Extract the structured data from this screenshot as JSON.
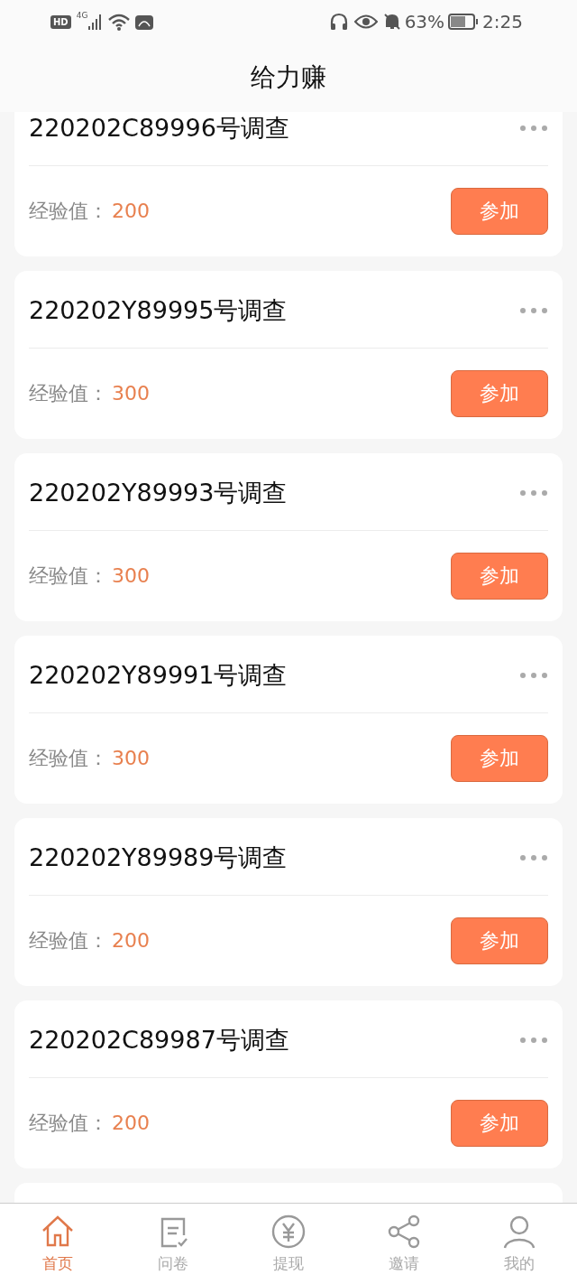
{
  "status_bar": {
    "hd_badge": "HD",
    "network_type": "4G",
    "battery": "63%",
    "time": "2:25"
  },
  "header": {
    "title": "给力赚"
  },
  "surveys": [
    {
      "title": "220202C89996号调查",
      "exp_label": "经验值：",
      "exp_value": "200",
      "button": "参加"
    },
    {
      "title": "220202Y89995号调查",
      "exp_label": "经验值：",
      "exp_value": "300",
      "button": "参加"
    },
    {
      "title": "220202Y89993号调查",
      "exp_label": "经验值：",
      "exp_value": "300",
      "button": "参加"
    },
    {
      "title": "220202Y89991号调查",
      "exp_label": "经验值：",
      "exp_value": "300",
      "button": "参加"
    },
    {
      "title": "220202Y89989号调查",
      "exp_label": "经验值：",
      "exp_value": "200",
      "button": "参加"
    },
    {
      "title": "220202C89987号调查",
      "exp_label": "经验值：",
      "exp_value": "200",
      "button": "参加"
    }
  ],
  "tab_bar": [
    {
      "label": "首页",
      "kind": "home",
      "selected": true
    },
    {
      "label": "问卷",
      "kind": "form",
      "selected": false
    },
    {
      "label": "提现",
      "kind": "yuan",
      "selected": false
    },
    {
      "label": "邀请",
      "kind": "share",
      "selected": false
    },
    {
      "label": "我的",
      "kind": "user",
      "selected": false
    }
  ]
}
